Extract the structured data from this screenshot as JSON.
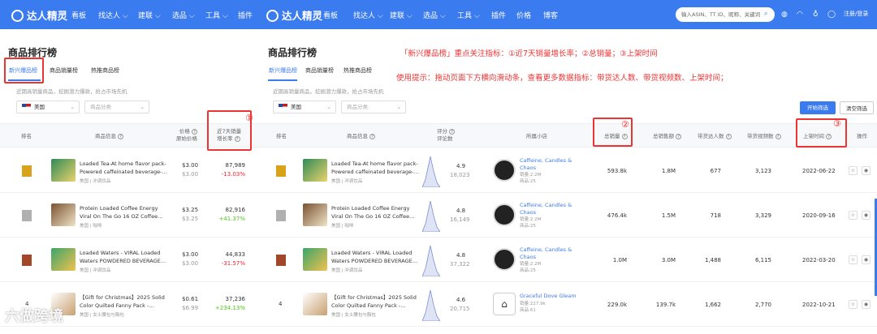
{
  "nav": {
    "logo": "达人精灵",
    "items": [
      "看板",
      "找达人",
      "建联",
      "选品",
      "工具",
      "插件",
      "价格",
      "博客"
    ],
    "search_placeholder": "输入ASIN、TT ID、昵称、关键词",
    "user": "注册/登录"
  },
  "page": {
    "title": "商品排行榜",
    "tabs": [
      "新兴爆品榜",
      "商品销量榜",
      "热推商品榜"
    ],
    "hint": "近期高销量商品，挖掘潜力爆款，抢占市场先机",
    "country": "美国",
    "category_placeholder": "商品分类",
    "btn_filter": "开始筛选",
    "btn_clear": "清空筛选"
  },
  "left_headers": {
    "rank": "排名",
    "info": "商品信息",
    "price1": "价格",
    "price2": "原始价格",
    "growth1": "近7天销量",
    "growth2": "增长率"
  },
  "right_headers": {
    "rank": "排名",
    "info": "商品信息",
    "rating1": "评分",
    "rating2": "评论数",
    "shop": "所属小店",
    "sales": "总销量",
    "revenue": "总销售额",
    "creators": "带货达人数",
    "videos": "带货视频数",
    "date": "上架时间",
    "ops": "操作"
  },
  "products": [
    {
      "rank": "",
      "medal": "#d9a21b",
      "name1": "Loaded Tea-At home flavor pack-",
      "name2": "Powered caffeinated beverage-…",
      "cat": "美国 | 冲调饮品",
      "price": "$3.00",
      "orig": "$3.00",
      "growth_sales": "87,989",
      "growth_rate": "-13.03%",
      "dir": "down",
      "rating": "4.9",
      "reviews": "18,023",
      "shop": [
        "Caffeine, Candles &",
        "Chaos"
      ],
      "shop_sales": "销量:2.2M",
      "shop_items": "商品:25",
      "sales": "593.8k",
      "revenue": "1.8M",
      "creators": "677",
      "videos": "3,123",
      "date": "2022-06-22",
      "img": [
        "#2e8b57",
        "#e9d36c"
      ]
    },
    {
      "rank": "",
      "medal": "#b0b0b0",
      "name1": "Protein Loaded Coffee Energy",
      "name2": "Viral On The Go 16 OZ Coffee…",
      "cat": "美国 | 咖啡",
      "price": "$3.25",
      "orig": "$3.25",
      "growth_sales": "82,916",
      "growth_rate": "+41.37%",
      "dir": "up",
      "rating": "4.8",
      "reviews": "16,149",
      "shop": [
        "Caffeine, Candles &",
        "Chaos"
      ],
      "shop_sales": "销量:2.2M",
      "shop_items": "商品:25",
      "sales": "476.4k",
      "revenue": "1.5M",
      "creators": "718",
      "videos": "3,329",
      "date": "2020-09-16",
      "img": [
        "#7a5230",
        "#f0e4c8"
      ]
    },
    {
      "rank": "",
      "medal": "#a3472b",
      "name1": "Loaded Waters - VIRAL Loaded",
      "name2": "Waters POWDERED BEVERAGE…",
      "cat": "美国 | 冲调饮品",
      "price": "$3.00",
      "orig": "$3.00",
      "growth_sales": "44,833",
      "growth_rate": "-31.57%",
      "dir": "down",
      "rating": "4.8",
      "reviews": "37,322",
      "shop": [
        "Caffeine, Candles &",
        "Chaos"
      ],
      "shop_sales": "销量:2.2M",
      "shop_items": "商品:25",
      "sales": "1.0M",
      "revenue": "3.0M",
      "creators": "1,488",
      "videos": "6,115",
      "date": "2022-03-20",
      "img": [
        "#3aa56b",
        "#f2c14e"
      ]
    },
    {
      "rank": "4",
      "medal": "",
      "name1": "【Gift for Christmas】2025 Solid",
      "name2": "Color Quilted Fanny Pack -…",
      "cat": "美国 | 女士腰包与胸包",
      "price": "$0.61",
      "orig": "$6.99",
      "growth_sales": "37,236",
      "growth_rate": "+234.13%",
      "dir": "up",
      "rating": "4.6",
      "reviews": "20,715",
      "shop": [
        "Graceful Dove Gleam"
      ],
      "shop_sales": "销量:227.9k",
      "shop_items": "商品:61",
      "sales": "229.0k",
      "revenue": "139.7k",
      "creators": "1,662",
      "videos": "2,770",
      "date": "2022-10-21",
      "img": [
        "#ffffff",
        "#c9a070"
      ]
    }
  ],
  "annotations": {
    "title": "「新兴爆品榜」重点关注指标：①近7天销量增长率；②总销量；③上架时间",
    "tip": "使用提示：拖动页面下方横向滑动条，查看更多数据指标：带货达人数、带货视频数、上架时间；",
    "n1": "①",
    "n2": "②",
    "n3": "③"
  },
  "watermark": "六做跨境",
  "colors": {
    "brand": "#3b7bf0",
    "annotation": "#e33333",
    "up": "#52c41a",
    "down": "#f5222d"
  }
}
